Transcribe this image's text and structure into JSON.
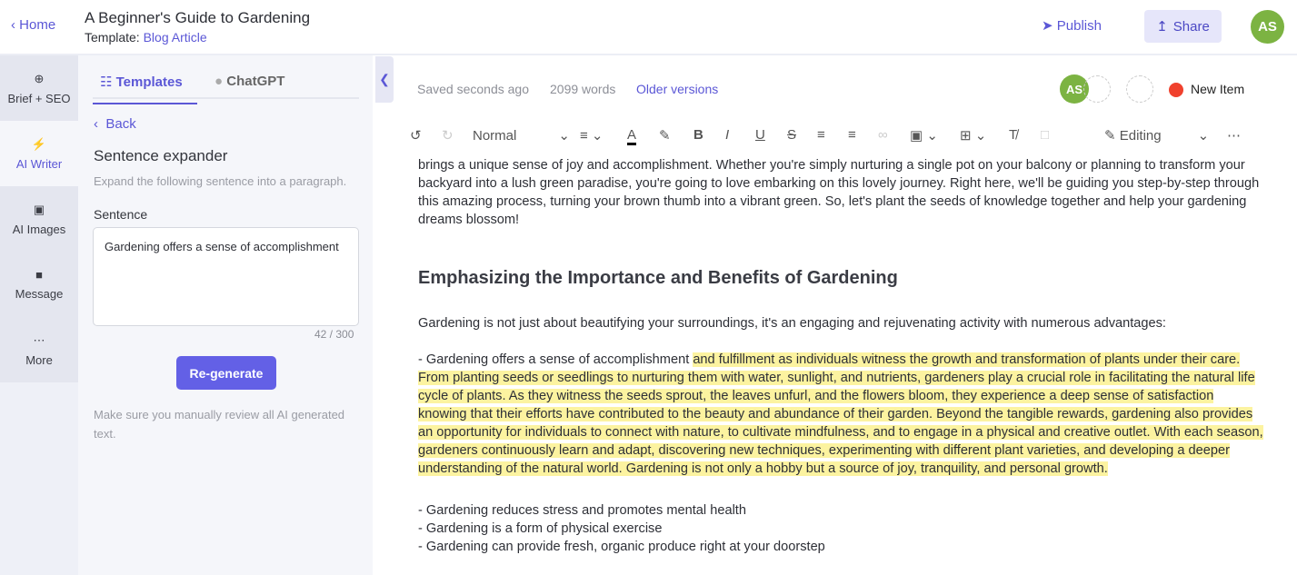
{
  "header": {
    "home": "Home",
    "title": "A Beginner's Guide to Gardening",
    "template_label": "Template:",
    "template_name": "Blog Article",
    "publish": "Publish",
    "share": "Share",
    "avatar": "AS"
  },
  "rail": [
    {
      "label": "Brief + SEO",
      "icon": "crosshair-icon"
    },
    {
      "label": "AI Writer",
      "icon": "lightning-icon"
    },
    {
      "label": "AI Images",
      "icon": "image-icon"
    },
    {
      "label": "Message",
      "icon": "message-icon"
    },
    {
      "label": "More",
      "icon": "more-icon"
    }
  ],
  "panel": {
    "tabs": [
      "Templates",
      "ChatGPT"
    ],
    "back": "Back",
    "heading": "Sentence expander",
    "description": "Expand the following sentence into a paragraph.",
    "field_label": "Sentence",
    "field_value": "Gardening offers a sense of accomplishment",
    "count": "42 / 300",
    "regenerate": "Re-generate",
    "note": "Make sure you manually review all AI generated text."
  },
  "editor": {
    "saved": "Saved seconds ago",
    "words": "2099 words",
    "older": "Older versions",
    "avatar": "AS",
    "status": "New Item",
    "status_color": "#f0412d",
    "style": "Normal",
    "mode": "Editing",
    "intro": "brings a unique sense of joy and accomplishment. Whether you're simply nurturing a single pot on your balcony or planning to transform your backyard into a lush green paradise, you're going to love embarking on this lovely journey. Right here, we'll be guiding you step-by-step through this amazing process, turning your brown thumb into a vibrant green. So, let's plant the seeds of knowledge together and help your gardening dreams blossom!",
    "heading": "Emphasizing the Importance and Benefits of Gardening",
    "para": "Gardening is not just about beautifying your surroundings, it's an engaging and rejuvenating activity with numerous advantages:",
    "bullet1_plain": "- Gardening offers a sense of accomplishment ",
    "bullet1_highlight": "and fulfillment as individuals witness the growth and transformation of plants under their care. From planting seeds or seedlings to nurturing them with water, sunlight, and nutrients, gardeners play a crucial role in facilitating the natural life cycle of plants. As they witness the seeds sprout, the leaves unfurl, and the flowers bloom, they experience a deep sense of satisfaction knowing that their efforts have contributed to the beauty and abundance of their garden. Beyond the tangible rewards, gardening also provides an opportunity for individuals to connect with nature, to cultivate mindfulness, and to engage in a physical and creative outlet. With each season, gardeners continuously learn and adapt, discovering new techniques, experimenting with different plant varieties, and developing a deeper understanding of the natural world. Gardening is not only a hobby but a source of joy, tranquility, and personal growth.",
    "bullets": [
      "- Gardening reduces stress and promotes mental health",
      "- Gardening is a form of physical exercise",
      "- Gardening can provide fresh, organic produce right at your doorstep"
    ],
    "highlight_color": "#fcf3a0"
  }
}
